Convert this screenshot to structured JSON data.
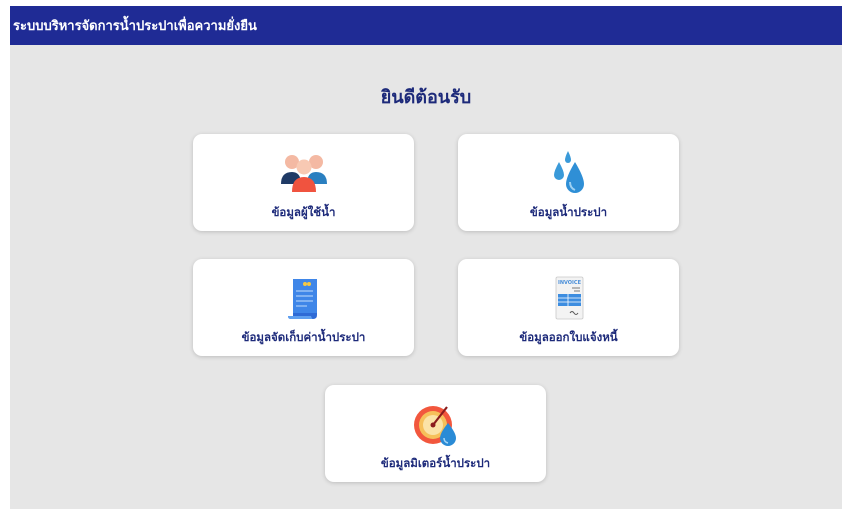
{
  "app": {
    "title": "ระบบบริหารจัดการน้ำประปาเพื่อความยั่งยืน"
  },
  "welcome": "ยินดีต้อนรับ",
  "cards": [
    {
      "label": "ข้อมูลผู้ใช้น้ำ",
      "icon": "users-icon"
    },
    {
      "label": "ข้อมูลน้ำประปา",
      "icon": "water-drops-icon"
    },
    {
      "label": "ข้อมูลจัดเก็บค่าน้ำประปา",
      "icon": "receipt-icon"
    },
    {
      "label": "ข้อมูลออกใบแจ้งหนี้",
      "icon": "invoice-icon",
      "icon_text": "INVOICE"
    },
    {
      "label": "ข้อมูลมิเตอร์น้ำประปา",
      "icon": "water-meter-icon"
    }
  ],
  "colors": {
    "header": "#1f2b95",
    "text": "#1d2a7a",
    "background": "#e6e6e6"
  }
}
